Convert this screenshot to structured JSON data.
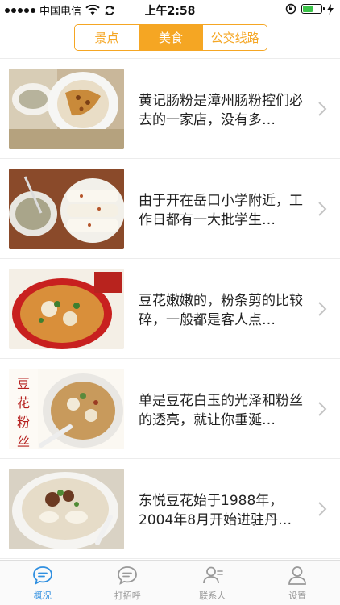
{
  "status_bar": {
    "carrier": "中国电信",
    "time": "上午2:58",
    "battery_level": 0.55
  },
  "segmented": {
    "tabs": [
      {
        "label": "景点",
        "active": false
      },
      {
        "label": "美食",
        "active": true
      },
      {
        "label": "公交线路",
        "active": false
      }
    ]
  },
  "items": [
    {
      "text": "黄记肠粉是漳州肠粉控们必去的一家店，没有多…",
      "image": "cheung-fun-plate-photo"
    },
    {
      "text": "由于开在岳口小学附近，工作日都有一大批学生…",
      "image": "rice-rolls-and-soup-photo"
    },
    {
      "text": "豆花嫩嫩的，粉条剪的比较碎，一般都是客人点…",
      "image": "tofu-noodle-bowl-photo"
    },
    {
      "text": "单是豆花白玉的光泽和粉丝的透亮，就让你垂涎…",
      "image": "tofu-vermicelli-bowl-photo"
    },
    {
      "text": "东悦豆花始于1988年，2004年8月开始进驻丹…",
      "image": "dongyue-tofu-bowl-photo"
    }
  ],
  "tab_bar": {
    "tabs": [
      {
        "label": "概况",
        "icon": "chat-bubble-icon",
        "active": true
      },
      {
        "label": "打招呼",
        "icon": "greet-bubble-icon",
        "active": false
      },
      {
        "label": "联系人",
        "icon": "contacts-icon",
        "active": false
      },
      {
        "label": "设置",
        "icon": "person-settings-icon",
        "active": false
      }
    ]
  },
  "colors": {
    "accent": "#f5a623",
    "tab_active": "#2f8fe0",
    "tab_inactive": "#999999"
  }
}
